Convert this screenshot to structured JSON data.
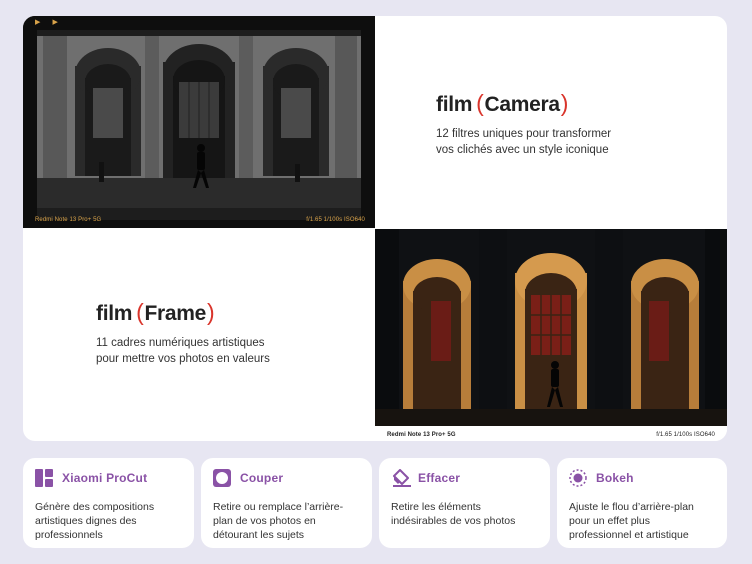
{
  "photo_top": {
    "flags": [
      "▶",
      "▶"
    ],
    "device_label": "Redmi Note 13 Pro+ 5G",
    "exif": "f/1.65  1/100s  ISO640"
  },
  "film_camera": {
    "prefix": "film",
    "open": "(",
    "name": "Camera",
    "close": ")",
    "desc_line1": "12 filtres uniques pour transformer",
    "desc_line2": "vos clichés avec un style iconique"
  },
  "film_frame": {
    "prefix": "film",
    "open": "(",
    "name": "Frame",
    "close": ")",
    "desc_line1": "11 cadres numériques artistiques",
    "desc_line2": "pour mettre vos photos en valeurs"
  },
  "photo_bottom": {
    "device_label": "Redmi Note 13 Pro+ 5G",
    "exif": "f/1.65  1/100s  ISO640"
  },
  "tools": [
    {
      "icon": "procut-grid-icon",
      "title": "Xiaomi ProCut",
      "desc": [
        "Génère des compositions",
        "artistiques dignes des",
        "professionnels"
      ]
    },
    {
      "icon": "cutout-circle-icon",
      "title": "Couper",
      "desc": [
        "Retire ou remplace l’arrière-",
        "plan de vos photos en",
        "détourant les sujets"
      ]
    },
    {
      "icon": "eraser-icon",
      "title": "Effacer",
      "desc": [
        "Retire les éléments",
        "indésirables de vos photos"
      ]
    },
    {
      "icon": "bokeh-aperture-icon",
      "title": "Bokeh",
      "desc": [
        "Ajuste le flou d’arrière-plan",
        "pour un effet plus",
        "professionnel et artistique"
      ]
    }
  ],
  "colors": {
    "accent_purple": "#8a52a6",
    "paren_red": "#d9342b",
    "background": "#e7e6f2"
  }
}
